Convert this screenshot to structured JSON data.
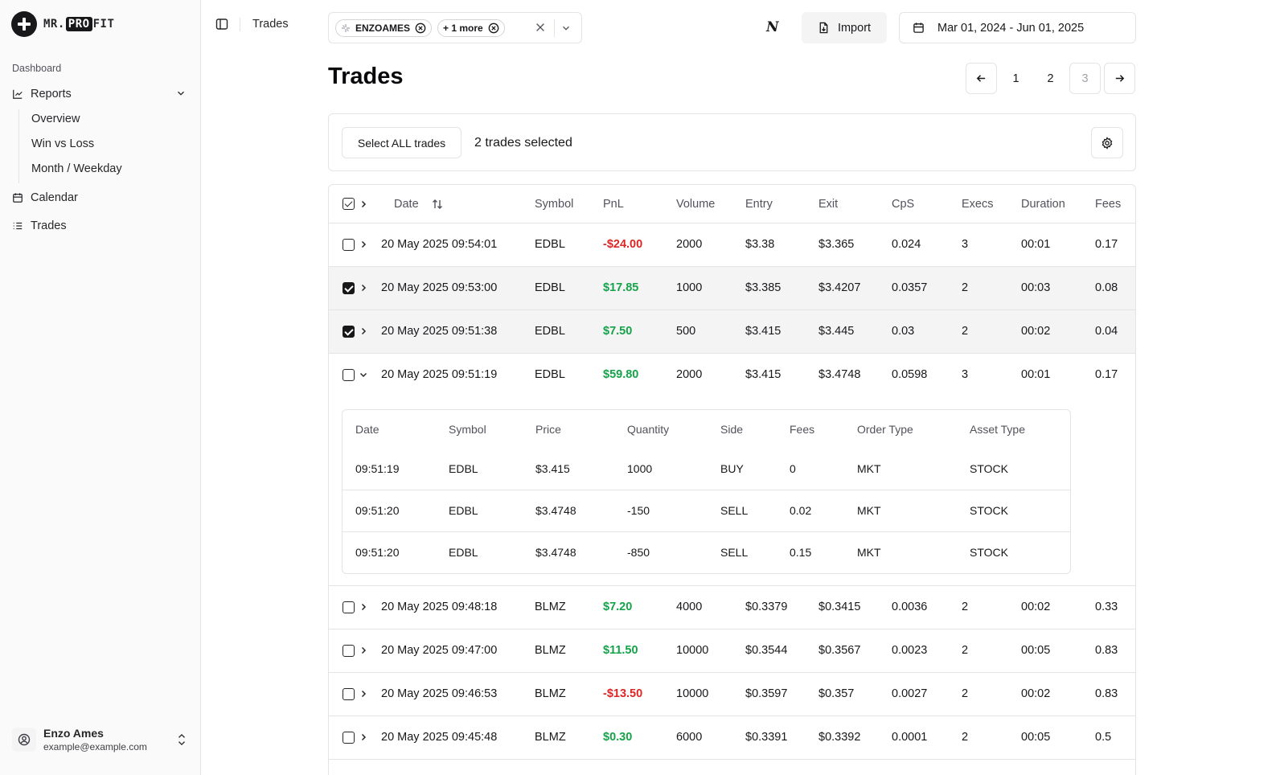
{
  "brand": {
    "prefix": "MR.",
    "highlight": "PRO",
    "suffix": "FIT"
  },
  "sidebar": {
    "group_label": "Dashboard",
    "reports_label": "Reports",
    "sub_items": [
      "Overview",
      "Win vs Loss",
      "Month / Weekday"
    ],
    "calendar_label": "Calendar",
    "trades_label": "Trades"
  },
  "user": {
    "name": "Enzo Ames",
    "email": "example@example.com"
  },
  "breadcrumb": "Trades",
  "account_filter": {
    "chip1": "ENZOAMES",
    "chip2": "+ 1 more"
  },
  "toolbar": {
    "n_label": "N",
    "import_label": "Import",
    "date_range": "Mar 01, 2024 - Jun 01, 2025"
  },
  "page_title": "Trades",
  "pagination": {
    "pages": [
      "1",
      "2",
      "3"
    ],
    "current": "3"
  },
  "selection": {
    "select_all_label": "Select ALL trades",
    "count_text": "2 trades selected"
  },
  "table": {
    "headers": [
      "Date",
      "Symbol",
      "PnL",
      "Volume",
      "Entry",
      "Exit",
      "CpS",
      "Execs",
      "Duration",
      "Fees"
    ],
    "rows": [
      {
        "date": "20 May 2025 09:54:01",
        "symbol": "EDBL",
        "pnl": "-$24.00",
        "volume": "2000",
        "entry": "$3.38",
        "exit": "$3.365",
        "cps": "0.024",
        "execs": "3",
        "duration": "00:01",
        "fees": "0.17"
      },
      {
        "date": "20 May 2025 09:53:00",
        "symbol": "EDBL",
        "pnl": "$17.85",
        "volume": "1000",
        "entry": "$3.385",
        "exit": "$3.4207",
        "cps": "0.0357",
        "execs": "2",
        "duration": "00:03",
        "fees": "0.08"
      },
      {
        "date": "20 May 2025 09:51:38",
        "symbol": "EDBL",
        "pnl": "$7.50",
        "volume": "500",
        "entry": "$3.415",
        "exit": "$3.445",
        "cps": "0.03",
        "execs": "2",
        "duration": "00:02",
        "fees": "0.04"
      },
      {
        "date": "20 May 2025 09:51:19",
        "symbol": "EDBL",
        "pnl": "$59.80",
        "volume": "2000",
        "entry": "$3.415",
        "exit": "$3.4748",
        "cps": "0.0598",
        "execs": "3",
        "duration": "00:01",
        "fees": "0.17"
      },
      {
        "date": "20 May 2025 09:48:18",
        "symbol": "BLMZ",
        "pnl": "$7.20",
        "volume": "4000",
        "entry": "$0.3379",
        "exit": "$0.3415",
        "cps": "0.0036",
        "execs": "2",
        "duration": "00:02",
        "fees": "0.33"
      },
      {
        "date": "20 May 2025 09:47:00",
        "symbol": "BLMZ",
        "pnl": "$11.50",
        "volume": "10000",
        "entry": "$0.3544",
        "exit": "$0.3567",
        "cps": "0.0023",
        "execs": "2",
        "duration": "00:05",
        "fees": "0.83"
      },
      {
        "date": "20 May 2025 09:46:53",
        "symbol": "BLMZ",
        "pnl": "-$13.50",
        "volume": "10000",
        "entry": "$0.3597",
        "exit": "$0.357",
        "cps": "0.0027",
        "execs": "2",
        "duration": "00:02",
        "fees": "0.83"
      },
      {
        "date": "20 May 2025 09:45:48",
        "symbol": "BLMZ",
        "pnl": "$0.30",
        "volume": "6000",
        "entry": "$0.3391",
        "exit": "$0.3392",
        "cps": "0.0001",
        "execs": "2",
        "duration": "00:05",
        "fees": "0.5"
      }
    ]
  },
  "executions": {
    "headers": [
      "Date",
      "Symbol",
      "Price",
      "Quantity",
      "Side",
      "Fees",
      "Order Type",
      "Asset Type"
    ],
    "rows": [
      {
        "date": "09:51:19",
        "symbol": "EDBL",
        "price": "$3.415",
        "quantity": "1000",
        "side": "BUY",
        "fees": "0",
        "order_type": "MKT",
        "asset_type": "STOCK"
      },
      {
        "date": "09:51:20",
        "symbol": "EDBL",
        "price": "$3.4748",
        "quantity": "-150",
        "side": "SELL",
        "fees": "0.02",
        "order_type": "MKT",
        "asset_type": "STOCK"
      },
      {
        "date": "09:51:20",
        "symbol": "EDBL",
        "price": "$3.4748",
        "quantity": "-850",
        "side": "SELL",
        "fees": "0.15",
        "order_type": "MKT",
        "asset_type": "STOCK"
      }
    ]
  },
  "colors": {
    "positive": "#15a34a",
    "negative": "#dc2626",
    "accent": "#18181b"
  }
}
